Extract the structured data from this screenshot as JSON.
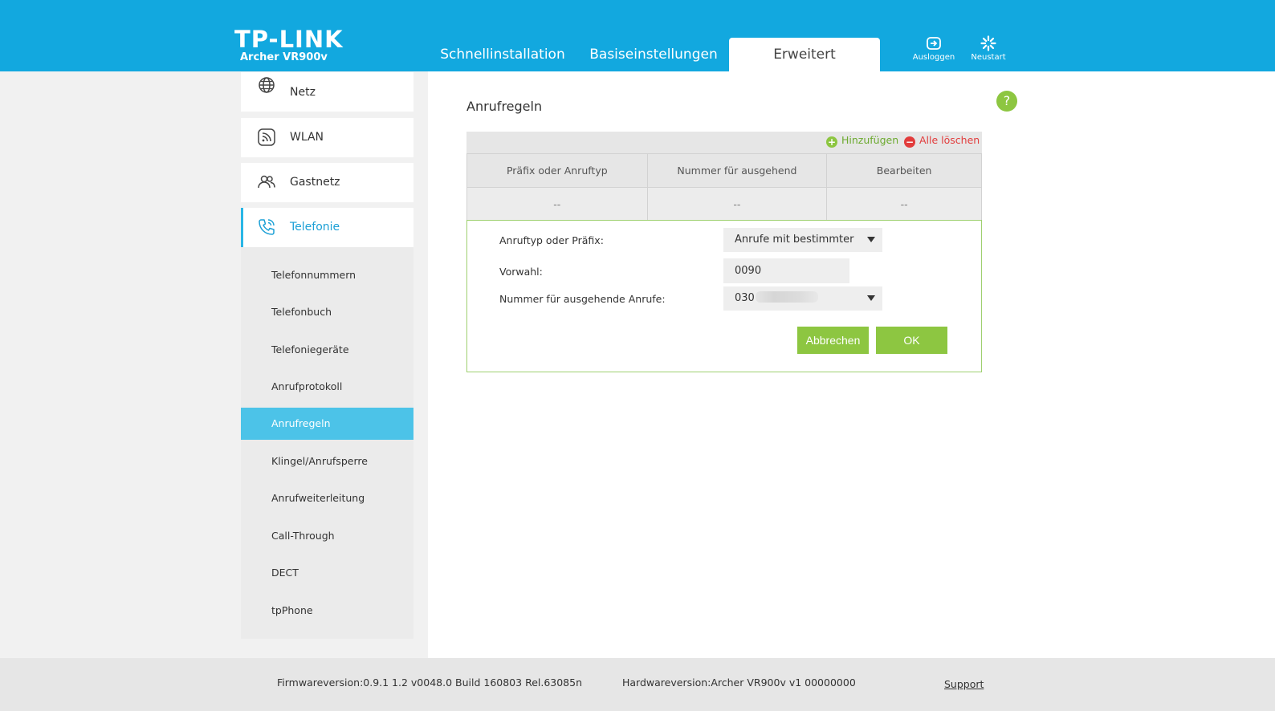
{
  "brand": {
    "logo": "TP-LINK",
    "model": "Archer VR900v"
  },
  "nav": {
    "tabs": [
      {
        "label": "Schnellinstallation"
      },
      {
        "label": "Basiseinstellungen"
      },
      {
        "label": "Erweitert",
        "active": true
      }
    ],
    "logout_label": "Ausloggen",
    "reboot_label": "Neustart"
  },
  "sidebar": {
    "main_items": [
      {
        "label": "Netz",
        "icon": "globe-icon"
      },
      {
        "label": "WLAN",
        "icon": "wireless-icon"
      },
      {
        "label": "Gastnetz",
        "icon": "guests-icon"
      },
      {
        "label": "Telefonie",
        "icon": "phone-icon",
        "active": true
      }
    ],
    "sub_items": [
      {
        "label": "Telefonnummern"
      },
      {
        "label": "Telefonbuch"
      },
      {
        "label": "Telefoniegeräte"
      },
      {
        "label": "Anrufprotokoll"
      },
      {
        "label": "Anrufregeln",
        "active": true
      },
      {
        "label": "Klingel/Anrufsperre"
      },
      {
        "label": "Anrufweiterleitung"
      },
      {
        "label": "Call-Through"
      },
      {
        "label": "DECT"
      },
      {
        "label": "tpPhone"
      }
    ]
  },
  "main": {
    "title": "Anrufregeln",
    "help": "?",
    "toolbar": {
      "add_label": "Hinzufügen",
      "delete_all_label": "Alle löschen"
    },
    "table": {
      "columns": [
        "Präfix oder Anruftyp",
        "Nummer für ausgehend",
        "Bearbeiten"
      ],
      "rows": [
        [
          "--",
          "--",
          "--"
        ]
      ]
    },
    "form": {
      "call_type_label": "Anruftyp oder Präfix:",
      "call_type_value": "Anrufe mit bestimmter",
      "prefix_label": "Vorwahl:",
      "prefix_value": "0090",
      "outgoing_label": "Nummer für ausgehende Anrufe:",
      "outgoing_value": "030",
      "cancel_label": "Abbrechen",
      "ok_label": "OK"
    }
  },
  "footer": {
    "firmware": "Firmwareversion:0.9.1 1.2 v0048.0 Build 160803 Rel.63085n",
    "hardware": "Hardwareversion:Archer VR900v v1 00000000",
    "support": "Support"
  },
  "colors": {
    "header": "#12a8df",
    "accent_green": "#8dc641",
    "active_blue": "#4cc3e8",
    "danger_red": "#e23c3c"
  }
}
